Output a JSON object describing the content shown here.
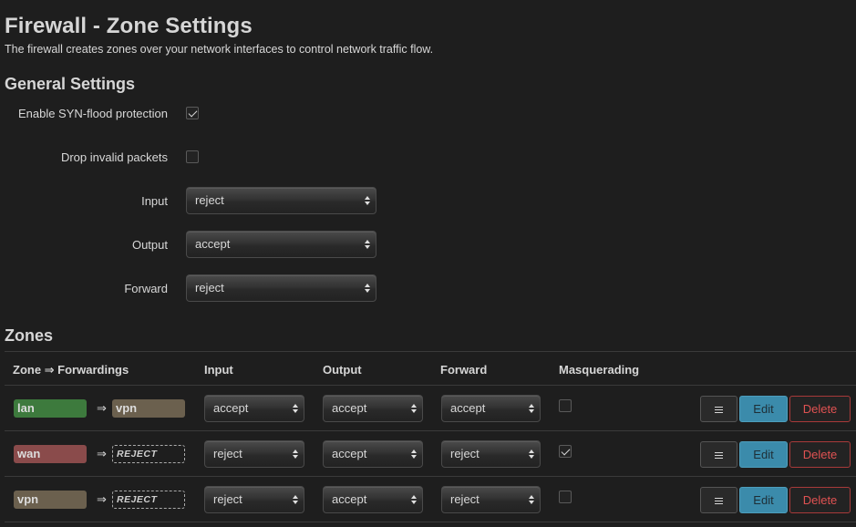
{
  "header": {
    "title": "Firewall - Zone Settings",
    "description": "The firewall creates zones over your network interfaces to control network traffic flow."
  },
  "general": {
    "title": "General Settings",
    "syn_flood_label": "Enable SYN-flood protection",
    "syn_flood_checked": true,
    "drop_invalid_label": "Drop invalid packets",
    "drop_invalid_checked": false,
    "input_label": "Input",
    "input_value": "reject",
    "output_label": "Output",
    "output_value": "accept",
    "forward_label": "Forward",
    "forward_value": "reject"
  },
  "zones": {
    "title": "Zones",
    "columns": {
      "zone": "Zone ⇒ Forwardings",
      "input": "Input",
      "output": "Output",
      "forward": "Forward",
      "masq": "Masquerading"
    },
    "arrow": "⇒",
    "menu_icon": "menu-icon",
    "edit_label": "Edit",
    "delete_label": "Delete",
    "rows": [
      {
        "zone": "lan",
        "zone_color": "#3d7a3d",
        "forward_to": "vpn",
        "forward_color": "#6b604e",
        "forward_reject": false,
        "input": "accept",
        "output": "accept",
        "forward": "accept",
        "masq": false
      },
      {
        "zone": "wan",
        "zone_color": "#8a4b4b",
        "forward_to": "REJECT",
        "forward_reject": true,
        "input": "reject",
        "output": "accept",
        "forward": "reject",
        "masq": true
      },
      {
        "zone": "vpn",
        "zone_color": "#6b604e",
        "forward_to": "REJECT",
        "forward_reject": true,
        "input": "reject",
        "output": "accept",
        "forward": "reject",
        "masq": false
      }
    ]
  },
  "colors": {
    "background": "#1e1e1e",
    "edit_button": "#3b8bab",
    "delete_text": "#e05252"
  }
}
